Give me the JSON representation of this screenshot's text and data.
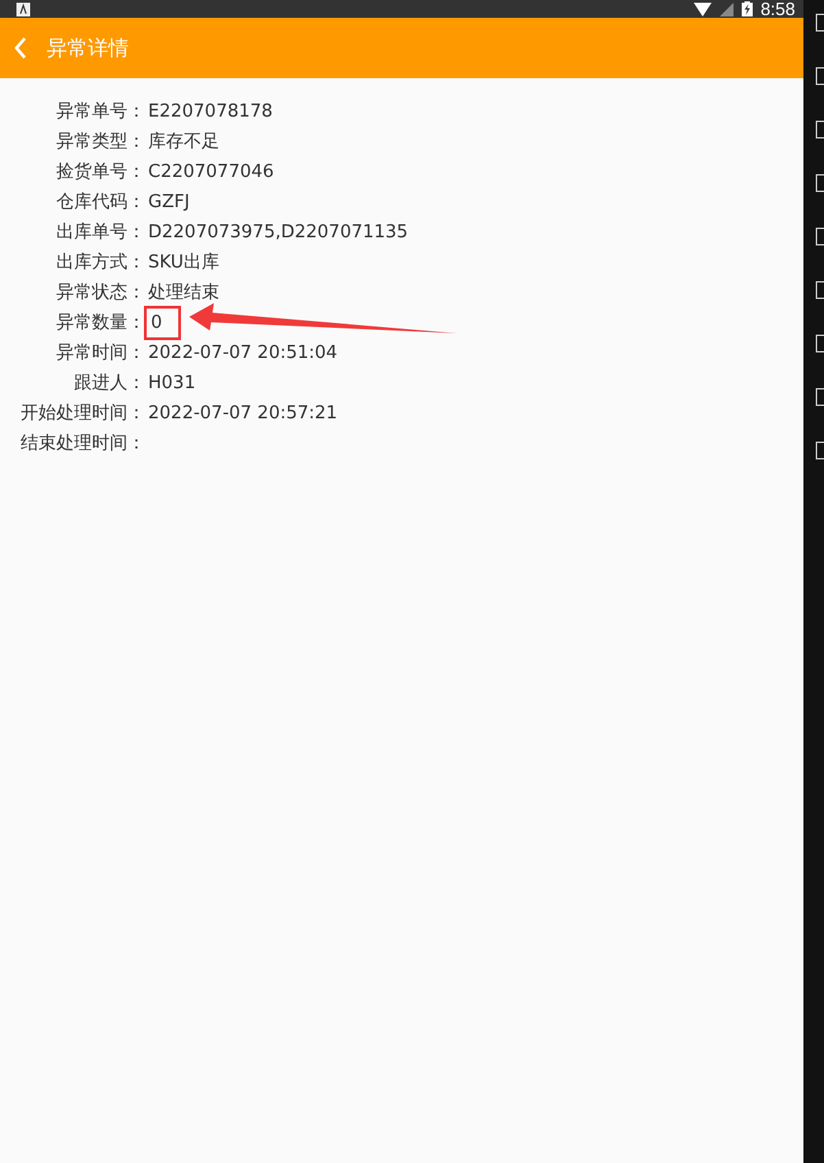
{
  "status_bar": {
    "time": "8:58"
  },
  "app_bar": {
    "title": "异常详情"
  },
  "fields": [
    {
      "label": "异常单号：",
      "value": "E2207078178",
      "highlighted": false
    },
    {
      "label": "异常类型：",
      "value": "库存不足",
      "highlighted": false
    },
    {
      "label": "捡货单号：",
      "value": "C2207077046",
      "highlighted": false
    },
    {
      "label": "仓库代码：",
      "value": "GZFJ",
      "highlighted": false
    },
    {
      "label": "出库单号：",
      "value": "D2207073975,D2207071135",
      "highlighted": false
    },
    {
      "label": "出库方式：",
      "value": "SKU出库",
      "highlighted": false
    },
    {
      "label": "异常状态：",
      "value": "处理结束",
      "highlighted": false
    },
    {
      "label": "异常数量：",
      "value": "0",
      "highlighted": true
    },
    {
      "label": "异常时间：",
      "value": "2022-07-07 20:51:04",
      "highlighted": false
    },
    {
      "label": "跟进人：",
      "value": "H031",
      "highlighted": false
    },
    {
      "label": "开始处理时间：",
      "value": "2022-07-07 20:57:21",
      "highlighted": false
    },
    {
      "label": "结束处理时间：",
      "highlighted": false
    }
  ]
}
